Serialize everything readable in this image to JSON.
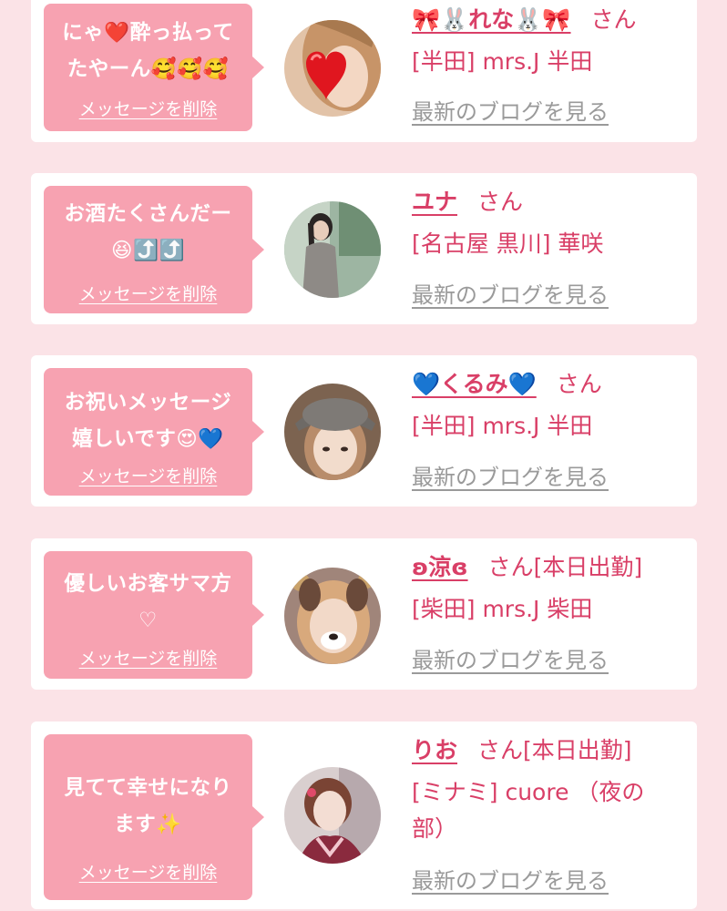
{
  "colors": {
    "page_background": "#fbe3e7",
    "card_background": "#ffffff",
    "bubble": "#f7a2b1",
    "accent": "#d93f67",
    "blog_link": "#9a9a9a"
  },
  "messages": [
    {
      "text": "にゃ❤️酔っ払って\nたやーん🥰🥰🥰",
      "delete_label": "メッセージを削除",
      "cast_name": "🎀🐰れな🐰🎀",
      "honorific": "さん",
      "status": "",
      "shop": "[半田] mrs.J 半田",
      "blog_label": "最新のブログを見る",
      "avatar": "photo-with-heart-sticker"
    },
    {
      "text": "お酒たくさんだー\n😆⤴️⤴️",
      "delete_label": "メッセージを削除",
      "cast_name": "ユナ",
      "honorific": "さん",
      "status": "",
      "shop": "[名古屋 黒川] 華咲",
      "blog_label": "最新のブログを見る",
      "avatar": "photo-woman-standing"
    },
    {
      "text": "お祝いメッセージ\n嬉しいです😍💙",
      "delete_label": "メッセージを削除",
      "cast_name": "💙くるみ💙",
      "honorific": "さん",
      "status": "",
      "shop": "[半田] mrs.J 半田",
      "blog_label": "最新のブログを見る",
      "avatar": "photo-woman-cap"
    },
    {
      "text": "優しいお客サマ方\n♡",
      "delete_label": "メッセージを削除",
      "cast_name": "ʚ涼ɞ",
      "honorific": "さん",
      "status": "[本日出勤]",
      "shop": "[柴田] mrs.J 柴田",
      "blog_label": "最新のブログを見る",
      "avatar": "photo-with-dog-filter"
    },
    {
      "text": "見てて幸せになり\nます✨",
      "delete_label": "メッセージを削除",
      "cast_name": "りお",
      "honorific": "さん",
      "status": "[本日出勤]",
      "shop": "[ミナミ] cuore （夜の部）",
      "blog_label": "最新のブログを見る",
      "avatar": "photo-woman-kimono"
    }
  ]
}
